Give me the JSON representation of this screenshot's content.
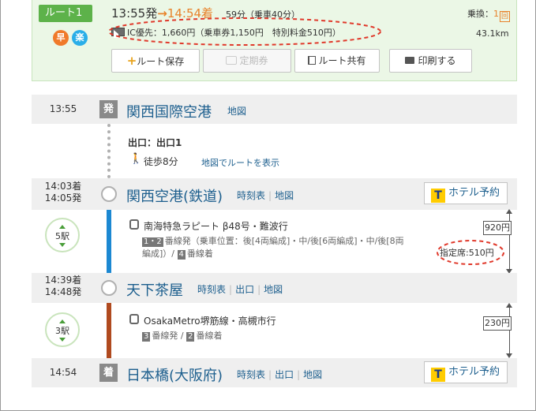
{
  "summary": {
    "route_label": "ルート1",
    "badge_fast": "早",
    "badge_easy": "楽",
    "depart": "13:55発",
    "arrow": "→",
    "arrive": "14:54着",
    "duration": "59分（乗車40分）",
    "transfer_label": "乗換：",
    "transfer_count": "1",
    "transfer_unit": "回",
    "fare": "IC優先：1,660円（乗車券1,150円　特別料金510円）",
    "distance": "43.1km",
    "buttons": {
      "save": "ルート保存",
      "pass": "定期券",
      "share": "ルート共有",
      "print": "印刷する"
    }
  },
  "stations": {
    "kansai_intl": {
      "time": "13:55",
      "mark": "発",
      "name": "関西国際空港",
      "map": "地図"
    },
    "walk": {
      "exit": "出口：出口1",
      "walk_time": "徒歩8分",
      "map_route": "地図でルートを表示"
    },
    "kix_rail": {
      "arr": "14:03着",
      "dep": "14:05発",
      "name": "関西空港(鉄道)",
      "timetable": "時刻表",
      "map": "地図",
      "hotel": "ホテル予約",
      "hotel_logo": "T"
    },
    "seg1": {
      "stops": "5駅",
      "train": "南海特急ラピート β48号・難波行",
      "platform_line1_pre": "番線発（乗車位置：後[4両編成]・中/後[6両編成]・中/後[8両",
      "platform_line2": "編成]）/",
      "platform_arr": "番線着",
      "p_dep": "1・2",
      "p_arr": "4",
      "fare": "920円",
      "reserved": "指定席:510円"
    },
    "tengachaya": {
      "arr": "14:39着",
      "dep": "14:48発",
      "name": "天下茶屋",
      "timetable": "時刻表",
      "exit": "出口",
      "map": "地図"
    },
    "seg2": {
      "stops": "3駅",
      "train": "OsakaMetro堺筋線・高槻市行",
      "p_dep": "3",
      "dep_txt": "番線発 /",
      "p_arr": "2",
      "arr_txt": "番線着",
      "fare": "230円"
    },
    "nippombashi": {
      "time": "14:54",
      "mark": "着",
      "name": "日本橋(大阪府)",
      "timetable": "時刻表",
      "exit": "出口",
      "map": "地図",
      "hotel": "ホテル予約",
      "hotel_logo": "T"
    }
  },
  "colors": {
    "line_nankai": "#1c88d2",
    "line_metro": "#b04a1f",
    "accent_orange": "#e8822a",
    "annotation_red": "#e0392b",
    "summary_bg": "#ebf7e6"
  }
}
